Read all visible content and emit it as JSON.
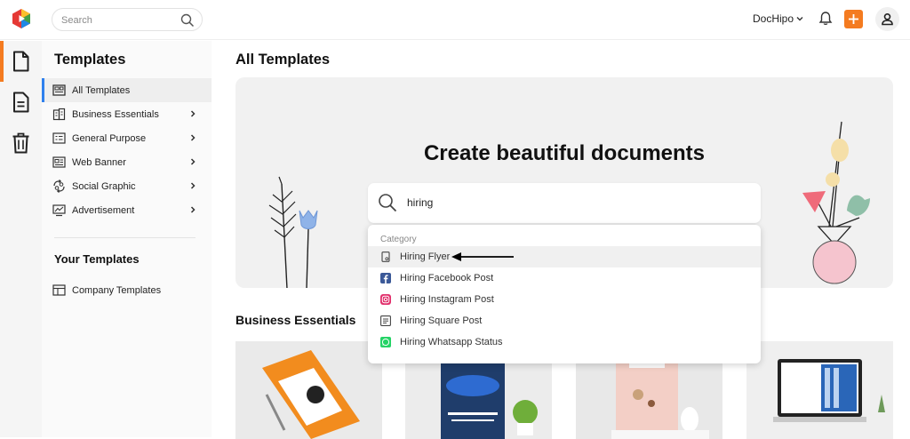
{
  "topbar": {
    "search_placeholder": "Search",
    "brand_name": "DocHipo",
    "accent_color": "#f47b20"
  },
  "rail": {
    "items": [
      {
        "icon": "document-icon",
        "active": true
      },
      {
        "icon": "file-text-icon",
        "active": false
      },
      {
        "icon": "trash-icon",
        "active": false
      }
    ]
  },
  "sidebar": {
    "title": "Templates",
    "items": [
      {
        "label": "All Templates",
        "icon": "grid-icon",
        "active": true
      },
      {
        "label": "Business Essentials",
        "icon": "building-icon",
        "has_children": true
      },
      {
        "label": "General Purpose",
        "icon": "list-icon",
        "has_children": true
      },
      {
        "label": "Web Banner",
        "icon": "banner-icon",
        "has_children": true
      },
      {
        "label": "Social Graphic",
        "icon": "social-icon",
        "has_children": true
      },
      {
        "label": "Advertisement",
        "icon": "ad-icon",
        "has_children": true
      }
    ],
    "your_templates_title": "Your Templates",
    "your_items": [
      {
        "label": "Company Templates",
        "icon": "layout-icon"
      }
    ]
  },
  "main": {
    "title": "All Templates",
    "hero": {
      "title": "Create beautiful documents",
      "search_value": "hiring"
    },
    "dropdown": {
      "category_label": "Category",
      "items": [
        {
          "label": "Hiring Flyer",
          "icon": "flyer-icon",
          "highlighted": true
        },
        {
          "label": "Hiring Facebook Post",
          "icon": "facebook-icon",
          "color": "#3b5998"
        },
        {
          "label": "Hiring Instagram Post",
          "icon": "instagram-icon",
          "color": "#e1306c"
        },
        {
          "label": "Hiring Square Post",
          "icon": "square-post-icon"
        },
        {
          "label": "Hiring Whatsapp Status",
          "icon": "whatsapp-icon",
          "color": "#25d366"
        }
      ]
    },
    "section_title": "Business Essentials"
  }
}
